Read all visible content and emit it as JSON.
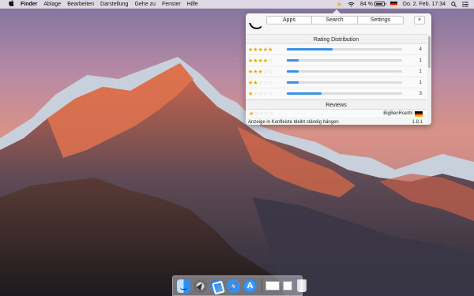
{
  "menubar": {
    "apple": "",
    "items": [
      "Finder",
      "Ablage",
      "Bearbeiten",
      "Darstellung",
      "Gehe zu",
      "Fenster",
      "Hilfe"
    ],
    "status": {
      "star": "★",
      "battery_text": "84 %",
      "battery_level": 0.84,
      "datetime": "Do. 2. Feb.  17:34",
      "search_icon": "search-icon",
      "menu_icon": "list-icon"
    }
  },
  "panel": {
    "tabs": [
      "Apps",
      "Search",
      "Settings"
    ],
    "close_label": "×",
    "rating_distribution": {
      "title": "Rating Distribution",
      "rows": [
        {
          "stars": 5,
          "count": "4",
          "fraction": 0.4
        },
        {
          "stars": 4,
          "count": "1",
          "fraction": 0.1
        },
        {
          "stars": 3,
          "count": "1",
          "fraction": 0.1
        },
        {
          "stars": 2,
          "count": "1",
          "fraction": 0.1
        },
        {
          "stars": 1,
          "count": "3",
          "fraction": 0.3
        }
      ]
    },
    "reviews": {
      "title": "Reviews",
      "items": [
        {
          "stars": 1,
          "author": "BigBenRoethl",
          "title": "Anzeige in Konfleiste bleibt ständig hängen",
          "version": "1.8.1"
        }
      ]
    }
  },
  "colors": {
    "star": "#e9a700",
    "bar": "#3f8fe6"
  }
}
